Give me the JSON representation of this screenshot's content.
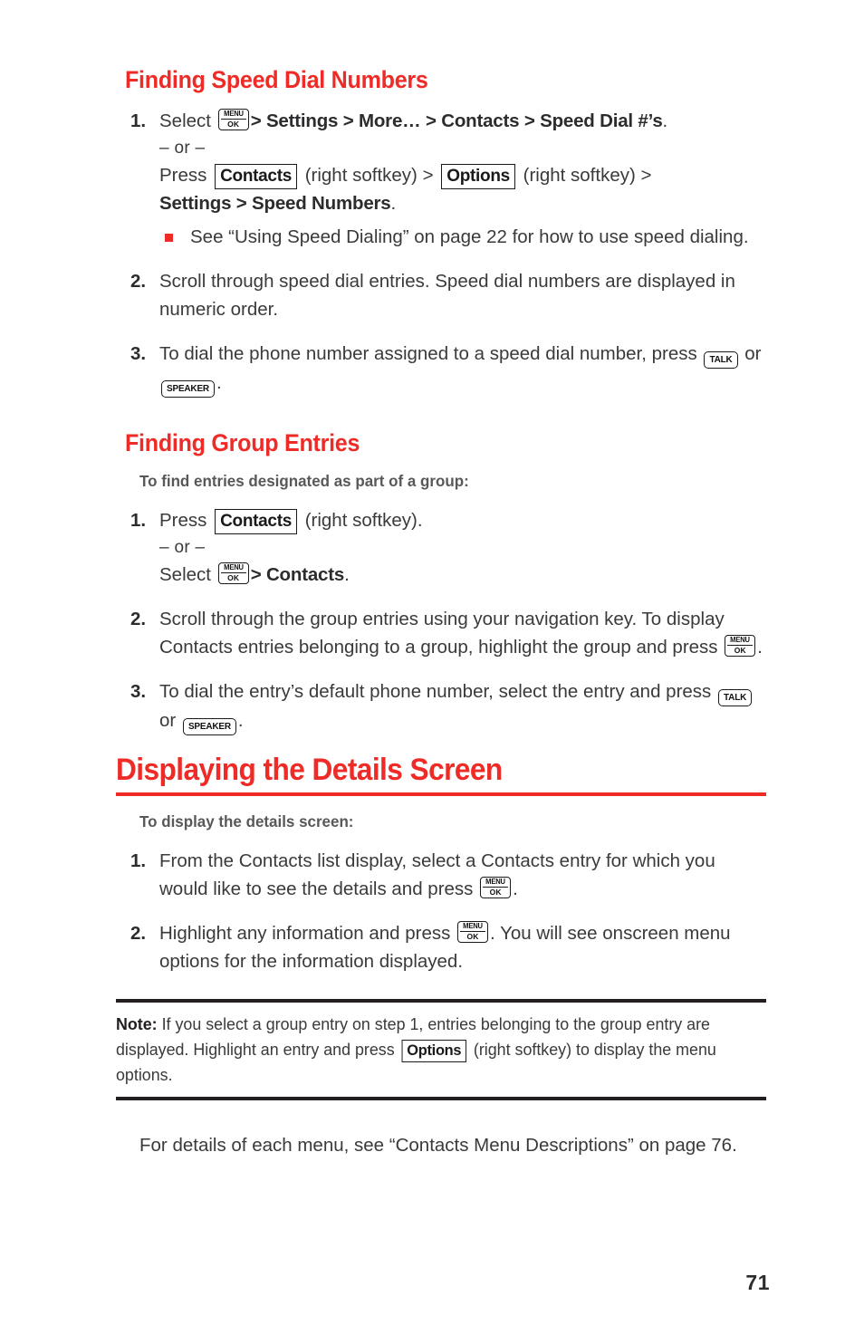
{
  "page": {
    "number": "71",
    "accent_color": "#ee2b26",
    "body_color": "#3a3a3c",
    "subhead_color": "#58585a"
  },
  "sections": [
    {
      "heading": "Finding Speed Dial Numbers",
      "steps": {
        "n1": "1.",
        "n2": "2.",
        "n3": "3."
      },
      "step1": {
        "select_label": "Select",
        "menu_key": {
          "top": "MENU",
          "bottom": "OK"
        },
        "path_a": "> Settings > More… > Contacts > Speed Dial #’s",
        "period": ".",
        "or_text": "– or –",
        "press_label": "Press",
        "softkey_contacts": "Contacts",
        "right_softkey_1": "(right softkey) >",
        "softkey_options": "Options",
        "right_softkey_2": "(right softkey) >",
        "path_b": "Settings > Speed Numbers",
        "path_b_period": ".",
        "bullet": "See “Using Speed Dialing” on page 22 for how to use speed dialing."
      },
      "step2": "Scroll through speed dial entries. Speed dial numbers are displayed in numeric order.",
      "step3": {
        "text_a": "To dial the phone number assigned to a speed dial number, press",
        "key_talk": "TALK",
        "or_label": "or",
        "key_speaker": "SPEAKER",
        "period": "."
      }
    },
    {
      "heading": "Finding Group Entries",
      "subhead": "To find entries designated as part of a group:",
      "steps": {
        "n1": "1.",
        "n2": "2.",
        "n3": "3."
      },
      "step1": {
        "press_label": "Press",
        "softkey_contacts": "Contacts",
        "right_softkey": "(right softkey).",
        "or_text": "– or –",
        "select_label": "Select",
        "menu_key": {
          "top": "MENU",
          "bottom": "OK"
        },
        "path": "> Contacts",
        "period": "."
      },
      "step2": {
        "text_a": "Scroll through the group entries using your navigation key. To display Contacts entries belonging to a group, highlight the group and press",
        "menu_key": {
          "top": "MENU",
          "bottom": "OK"
        },
        "period": "."
      },
      "step3": {
        "text_a": "To dial the entry’s default phone number, select the entry and press",
        "key_talk": "TALK",
        "or_label": "or",
        "key_speaker": "SPEAKER",
        "period": "."
      }
    }
  ],
  "main_section": {
    "heading": "Displaying the Details Screen",
    "subhead": "To display the details screen:",
    "steps": {
      "n1": "1.",
      "n2": "2."
    },
    "step1": {
      "text_a": "From the Contacts list display, select a Contacts entry for which you would like to see the details and press",
      "menu_key": {
        "top": "MENU",
        "bottom": "OK"
      },
      "period": "."
    },
    "step2": {
      "text_a": "Highlight any information and press",
      "menu_key": {
        "top": "MENU",
        "bottom": "OK"
      },
      "text_b": ". You will see onscreen menu options for the information displayed."
    }
  },
  "note": {
    "label": "Note:",
    "text_a": "If you select a group entry on step 1, entries belonging to the group entry are displayed. Highlight an entry and press",
    "softkey_options": "Options",
    "text_b": "(right softkey) to display the menu options."
  },
  "closing": "For details of each menu, see “Contacts Menu Descriptions” on page 76."
}
